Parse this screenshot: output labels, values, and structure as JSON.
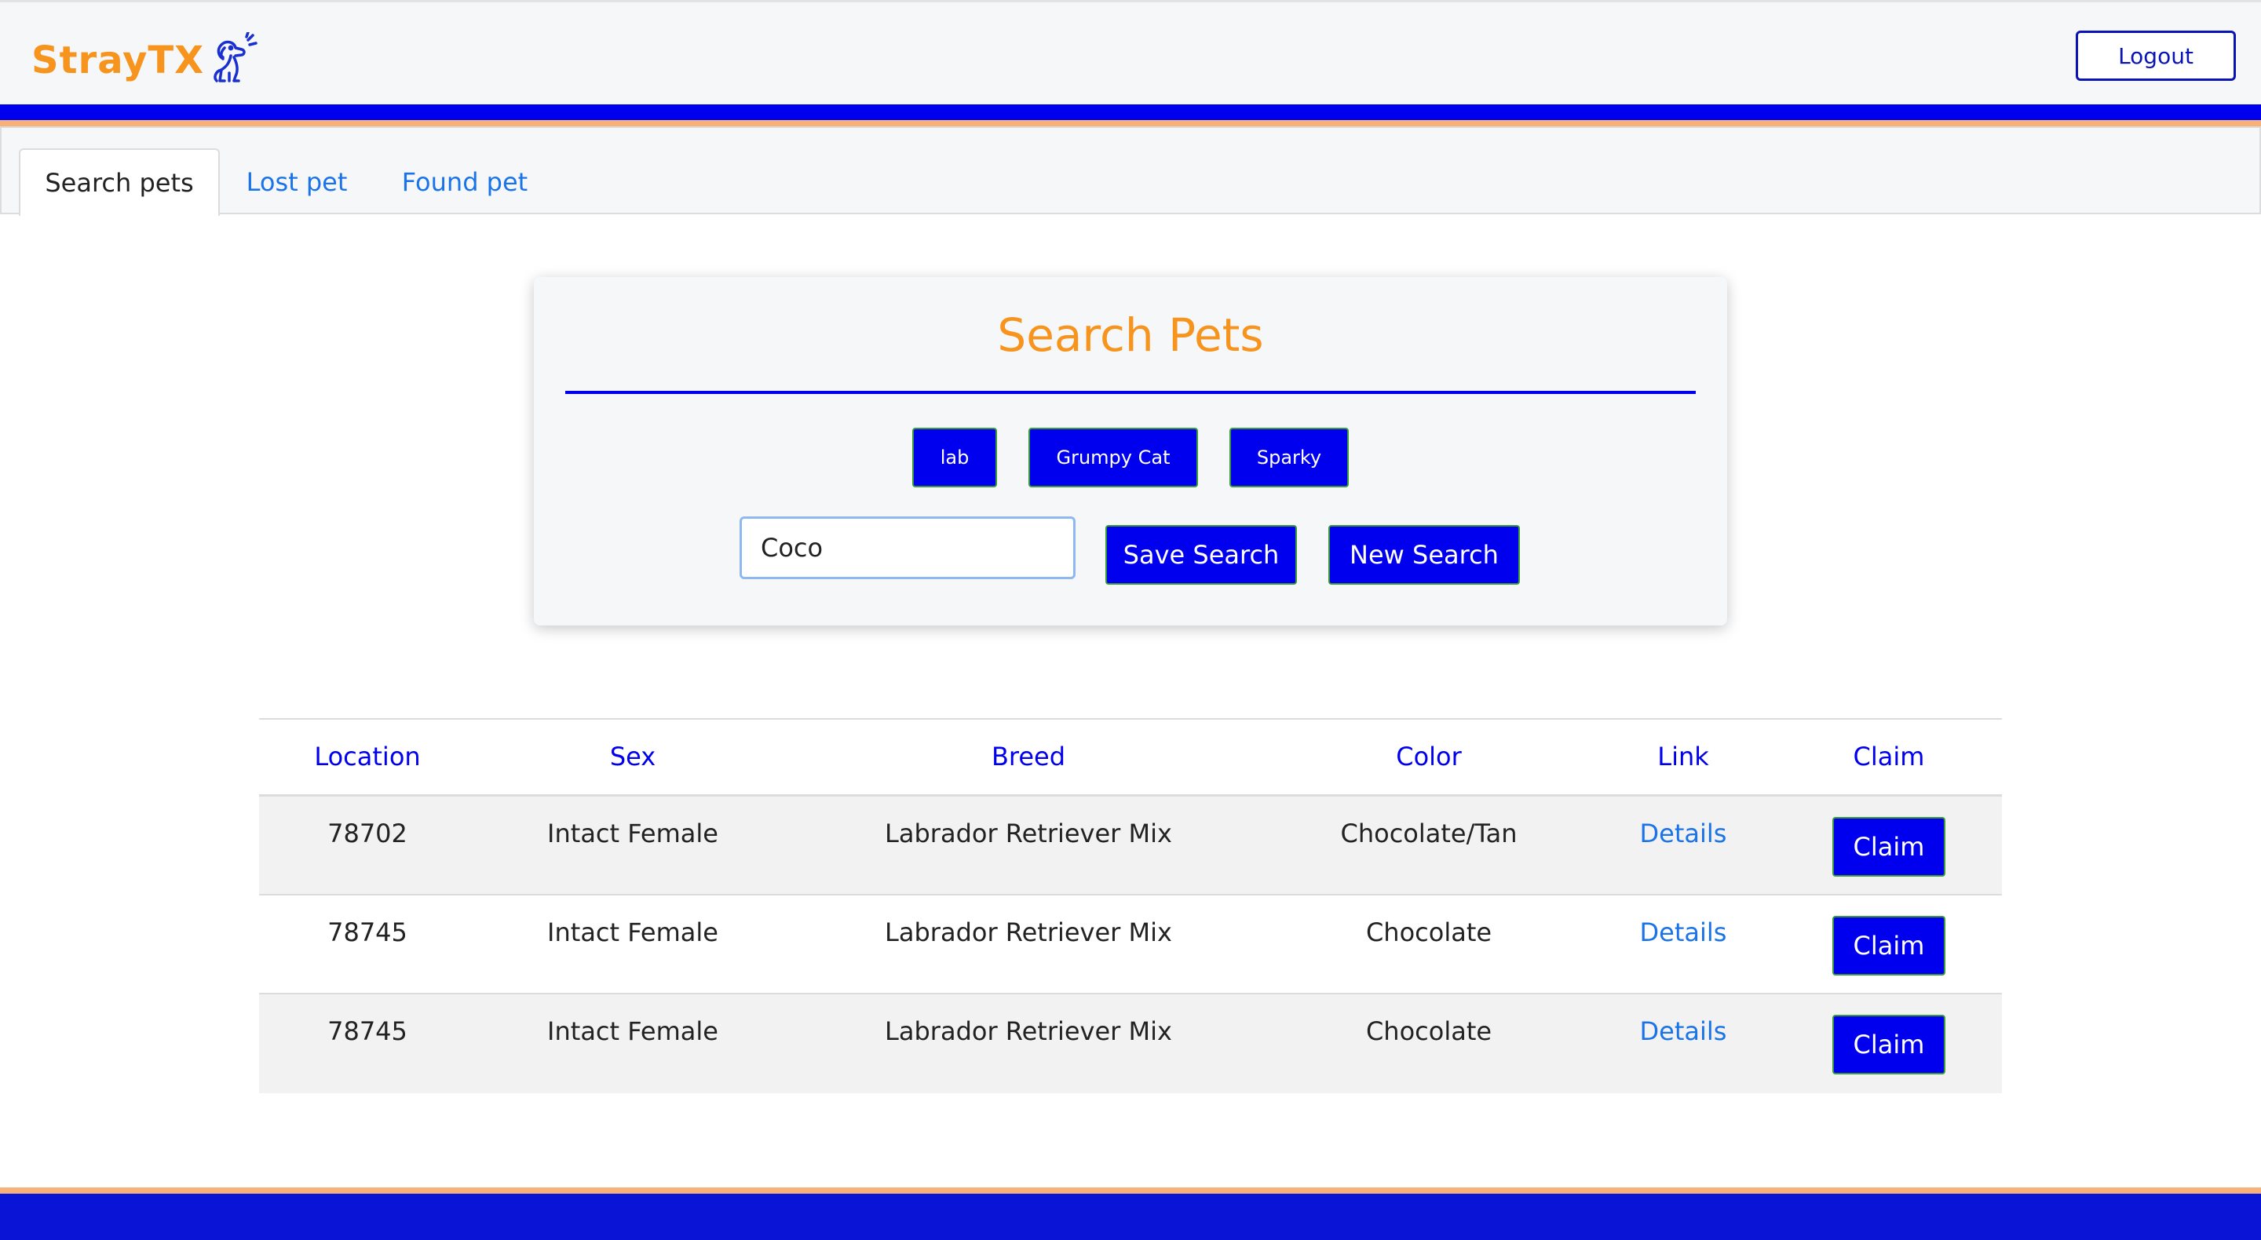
{
  "header": {
    "brand": "StrayTX",
    "logout_label": "Logout",
    "colors": {
      "brand": "#f7941d",
      "accent": "#0000ee",
      "stripe": "#f7b27a"
    }
  },
  "tabs": [
    {
      "label": "Search pets",
      "active": true
    },
    {
      "label": "Lost pet",
      "active": false
    },
    {
      "label": "Found pet",
      "active": false
    }
  ],
  "search": {
    "title": "Search Pets",
    "saved_searches": [
      "lab",
      "Grumpy Cat",
      "Sparky"
    ],
    "input_value": "Coco",
    "save_label": "Save Search",
    "new_label": "New Search"
  },
  "results": {
    "columns": [
      "Location",
      "Sex",
      "Breed",
      "Color",
      "Link",
      "Claim"
    ],
    "rows": [
      {
        "location": "78702",
        "sex": "Intact Female",
        "breed": "Labrador Retriever Mix",
        "color": "Chocolate/Tan",
        "link": "Details",
        "claim": "Claim"
      },
      {
        "location": "78745",
        "sex": "Intact Female",
        "breed": "Labrador Retriever Mix",
        "color": "Chocolate",
        "link": "Details",
        "claim": "Claim"
      },
      {
        "location": "78745",
        "sex": "Intact Female",
        "breed": "Labrador Retriever Mix",
        "color": "Chocolate",
        "link": "Details",
        "claim": "Claim"
      }
    ]
  }
}
